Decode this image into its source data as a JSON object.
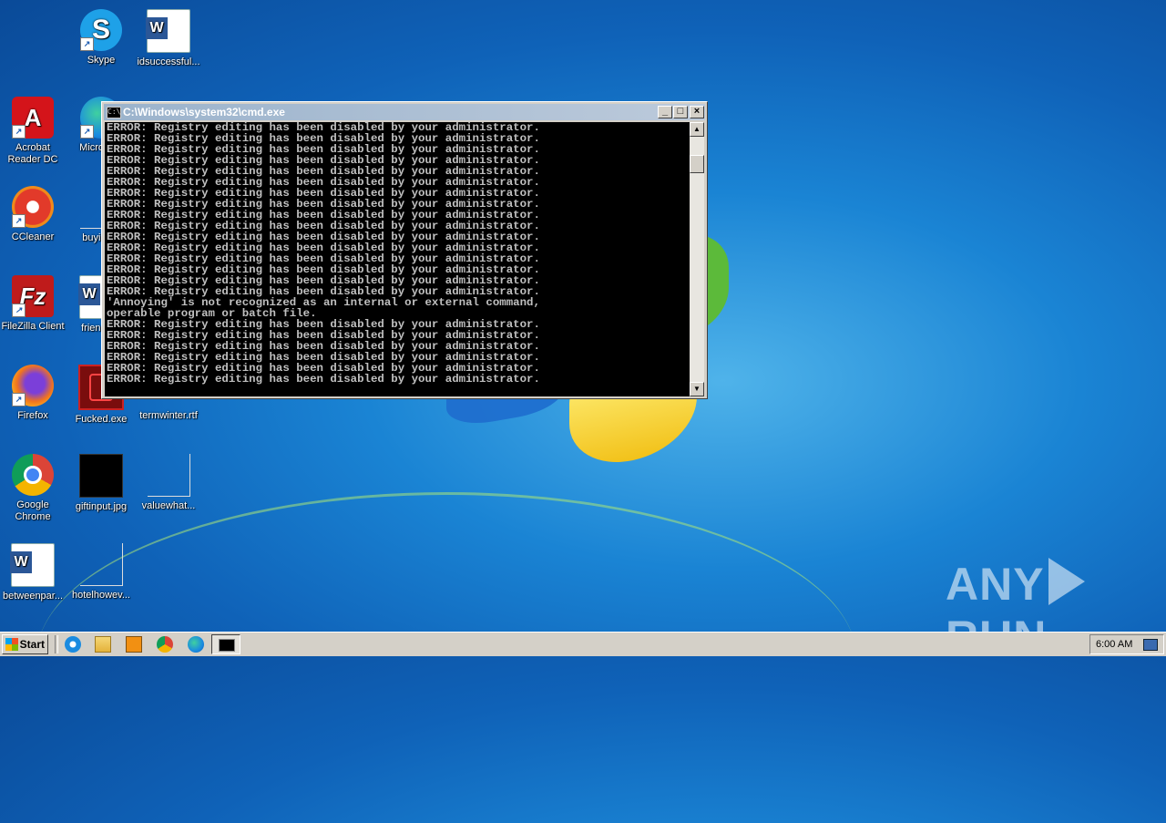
{
  "desktop": {
    "icons": [
      {
        "label": "Skype"
      },
      {
        "label": "idsuccessful..."
      },
      {
        "label": "Acrobat Reader DC"
      },
      {
        "label": "Microso..."
      },
      {
        "label": "CCleaner"
      },
      {
        "label": "buying..."
      },
      {
        "label": "FileZilla Client"
      },
      {
        "label": "friendly..."
      },
      {
        "label": "Firefox"
      },
      {
        "label": "Fucked.exe"
      },
      {
        "label": "termwinter.rtf"
      },
      {
        "label": "Google Chrome"
      },
      {
        "label": "giftinput.jpg"
      },
      {
        "label": "valuewhat..."
      },
      {
        "label": "betweenpar..."
      },
      {
        "label": "hotelhowev..."
      }
    ]
  },
  "cmd_window": {
    "title": "C:\\Windows\\system32\\cmd.exe",
    "lines": [
      "ERROR: Registry editing has been disabled by your administrator.",
      "ERROR: Registry editing has been disabled by your administrator.",
      "ERROR: Registry editing has been disabled by your administrator.",
      "ERROR: Registry editing has been disabled by your administrator.",
      "ERROR: Registry editing has been disabled by your administrator.",
      "ERROR: Registry editing has been disabled by your administrator.",
      "ERROR: Registry editing has been disabled by your administrator.",
      "ERROR: Registry editing has been disabled by your administrator.",
      "ERROR: Registry editing has been disabled by your administrator.",
      "ERROR: Registry editing has been disabled by your administrator.",
      "ERROR: Registry editing has been disabled by your administrator.",
      "ERROR: Registry editing has been disabled by your administrator.",
      "ERROR: Registry editing has been disabled by your administrator.",
      "ERROR: Registry editing has been disabled by your administrator.",
      "ERROR: Registry editing has been disabled by your administrator.",
      "ERROR: Registry editing has been disabled by your administrator.",
      "'Annoying' is not recognized as an internal or external command,",
      "operable program or batch file.",
      "ERROR: Registry editing has been disabled by your administrator.",
      "ERROR: Registry editing has been disabled by your administrator.",
      "ERROR: Registry editing has been disabled by your administrator.",
      "ERROR: Registry editing has been disabled by your administrator.",
      "ERROR: Registry editing has been disabled by your administrator.",
      "ERROR: Registry editing has been disabled by your administrator."
    ],
    "minimize_label": "_",
    "maximize_label": "□",
    "close_label": "×"
  },
  "taskbar": {
    "start_label": "Start",
    "clock": "6:00 AM"
  },
  "watermark": {
    "left": "ANY",
    "right": "RUN"
  }
}
